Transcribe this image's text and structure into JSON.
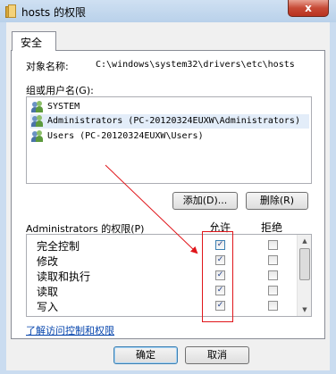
{
  "window": {
    "title": "hosts 的权限",
    "close_label": "x",
    "folder_icon": "folder-icon",
    "close_icon": "close-icon"
  },
  "tabs": [
    {
      "label": "安全"
    }
  ],
  "object": {
    "label": "对象名称:",
    "value": "C:\\windows\\system32\\drivers\\etc\\hosts"
  },
  "groups": {
    "label": "组或用户名(G):",
    "items": [
      {
        "name": "SYSTEM",
        "icon": "users-icon"
      },
      {
        "name": "Administrators (PC-20120324EUXW\\Administrators)",
        "icon": "users-icon"
      },
      {
        "name": "Users (PC-20120324EUXW\\Users)",
        "icon": "users-icon"
      }
    ],
    "selected_index": 1
  },
  "buttons": {
    "add": "添加(D)...",
    "remove": "删除(R)",
    "ok": "确定",
    "cancel": "取消"
  },
  "permissions": {
    "label": "Administrators 的权限(P)",
    "allow_header": "允许",
    "deny_header": "拒绝",
    "items": [
      {
        "name": "完全控制",
        "allow": true,
        "deny": false
      },
      {
        "name": "修改",
        "allow": true,
        "deny": false
      },
      {
        "name": "读取和执行",
        "allow": true,
        "deny": false
      },
      {
        "name": "读取",
        "allow": true,
        "deny": false
      },
      {
        "name": "写入",
        "allow": true,
        "deny": false
      }
    ]
  },
  "link": {
    "learn_more": "了解访问控制和权限"
  },
  "annotation": {
    "color": "#e0151a"
  }
}
